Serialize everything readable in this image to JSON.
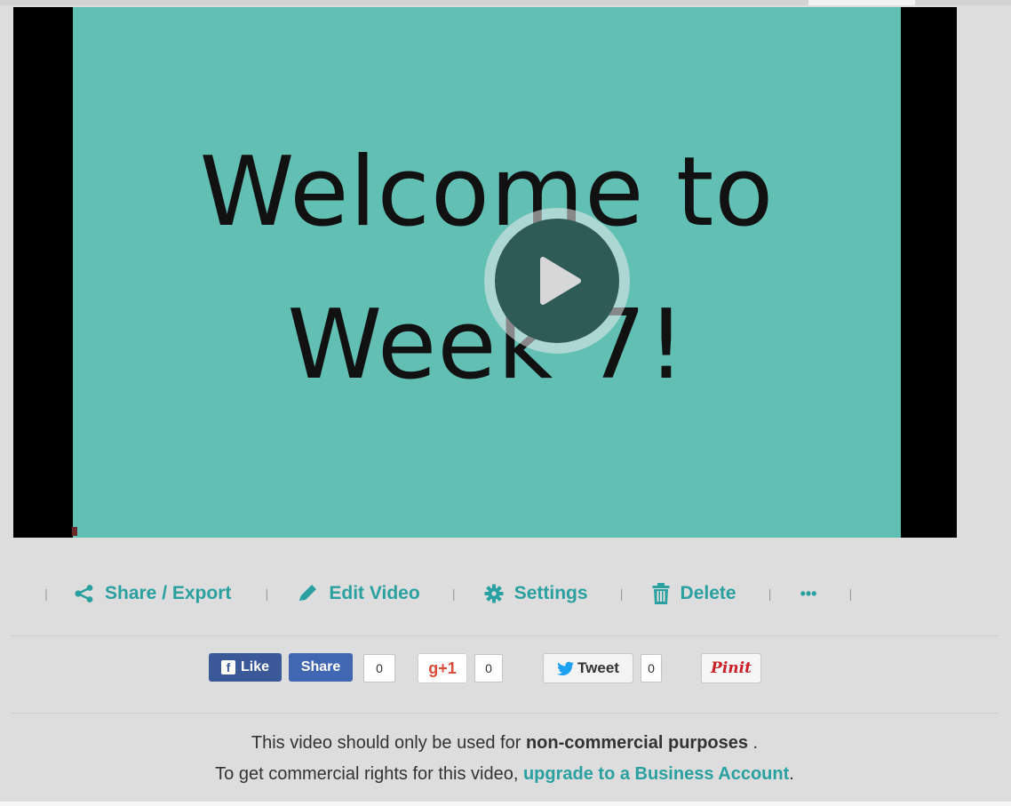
{
  "video": {
    "slide_line_1": "Welcome to",
    "slide_line_2": "Week 7!",
    "slide_background": "#62bfb3"
  },
  "actions": [
    {
      "label": "Share / Export",
      "icon": "share-icon"
    },
    {
      "label": "Edit Video",
      "icon": "pencil-icon"
    },
    {
      "label": "Settings",
      "icon": "gear-icon"
    },
    {
      "label": "Delete",
      "icon": "trash-icon"
    },
    {
      "label": "•••",
      "icon": "more-icon"
    }
  ],
  "social": {
    "fb_like": "Like",
    "fb_share": "Share",
    "fb_count": "0",
    "gplus_label": "g+1",
    "gplus_count": "0",
    "tweet_label": "Tweet",
    "tweet_count": "0",
    "pinit_label": "Pinit"
  },
  "notice": {
    "line1_prefix": "This video should only be used for ",
    "line1_bold": "non-commercial purposes",
    "line1_suffix": " .",
    "line2_prefix": "To get commercial rights for this video, ",
    "line2_link": "upgrade to a Business Account",
    "line2_suffix": "."
  },
  "colors": {
    "accent": "#2aa0a0",
    "facebook": "#3b5998",
    "gplus": "#dd4b39",
    "pinterest": "#cb2027"
  }
}
